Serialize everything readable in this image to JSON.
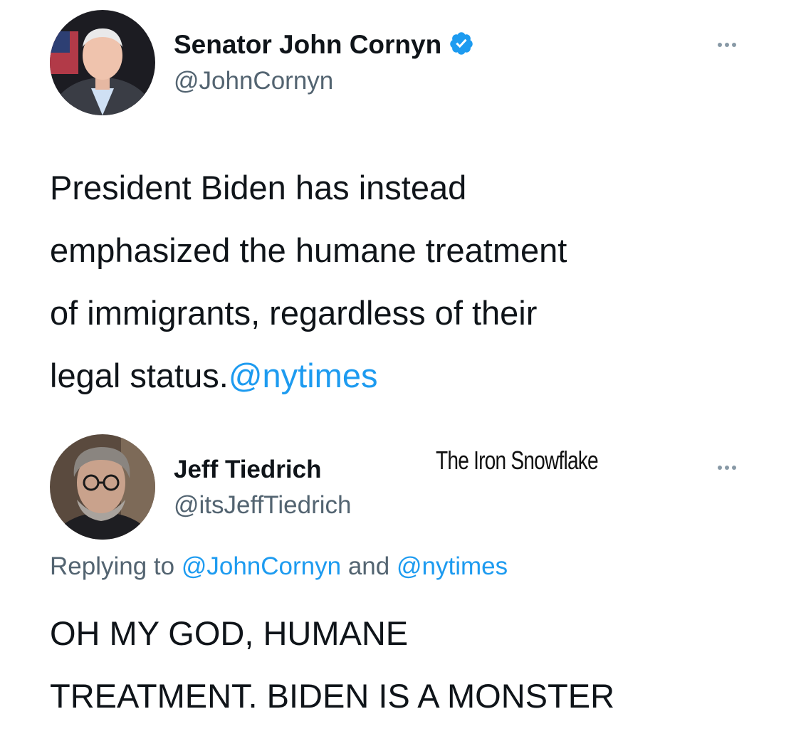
{
  "tweet1": {
    "author_name": "Senator John Cornyn",
    "author_handle": "@JohnCornyn",
    "verified": true,
    "text_lines": [
      "President Biden has instead",
      "emphasized the humane treatment",
      "of immigrants, regardless of their"
    ],
    "text_last_plain": "legal status.",
    "text_last_mention": "@nytimes"
  },
  "watermark": "The Iron Snowflake",
  "tweet2": {
    "author_name": "Jeff Tiedrich",
    "author_handle": "@itsJeffTiedrich",
    "replying_prefix": "Replying to",
    "replying_mention_1": "@JohnCornyn",
    "replying_and": "and",
    "replying_mention_2": "@nytimes",
    "text_lines": [
      "OH MY GOD, HUMANE",
      "TREATMENT. BIDEN IS A MONSTER"
    ]
  },
  "colors": {
    "accent": "#1d9bf0",
    "secondary_text": "#536471",
    "primary_text": "#0f1419"
  },
  "icons": [
    "verified-badge-icon",
    "more-options-icon"
  ]
}
